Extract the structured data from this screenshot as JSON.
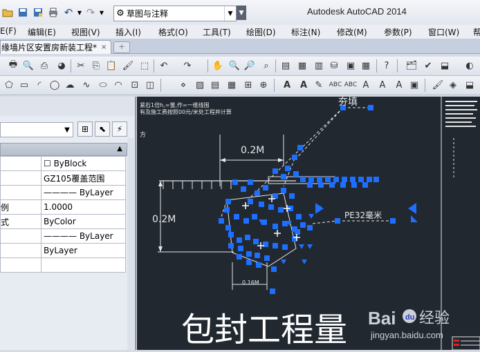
{
  "app_title": "Autodesk AutoCAD 2014",
  "workspace": {
    "selected": "草图与注释"
  },
  "menu": [
    "E(F)",
    "编辑(E)",
    "视图(V)",
    "插入(I)",
    "格式(O)",
    "工具(T)",
    "绘图(D)",
    "标注(N)",
    "修改(M)",
    "参数(P)",
    "窗口(W)",
    "帮"
  ],
  "tabs": [
    {
      "label": "缘墙片区安置房新装工程*",
      "close": "×"
    }
  ],
  "properties": {
    "rows": [
      {
        "key": "",
        "value": "☐ ByBlock"
      },
      {
        "key": "",
        "value": "GZ105覆盖范围"
      },
      {
        "key": "",
        "value": "———— ByLayer"
      },
      {
        "key": "例",
        "value": "1.0000"
      },
      {
        "key": "式",
        "value": "ByColor"
      },
      {
        "key": "",
        "value": "———— ByLayer"
      },
      {
        "key": "",
        "value": "ByLayer"
      },
      {
        "key": "",
        "value": ""
      }
    ]
  },
  "drawing": {
    "label_top": "夯填",
    "dim_horizontal": "0.2M",
    "dim_vertical": "0.2M",
    "dim_bottom": "0.16M",
    "pipe_label": "PE32毫米",
    "note_line1": "紧石1倍h,=雏,作=一维线围",
    "note_line2": "有及施工费按照00元/米处工程并计算",
    "side_label": "方",
    "big_caption": "包封工程量"
  },
  "watermark": {
    "brand": "Bai",
    "brand2": "du",
    "brand_cn": "经验",
    "url": "jingyan.baidu.com"
  },
  "colors": {
    "canvas": "#212830",
    "grip": "#1e6fff",
    "dim_text": "#e8e8e8"
  }
}
